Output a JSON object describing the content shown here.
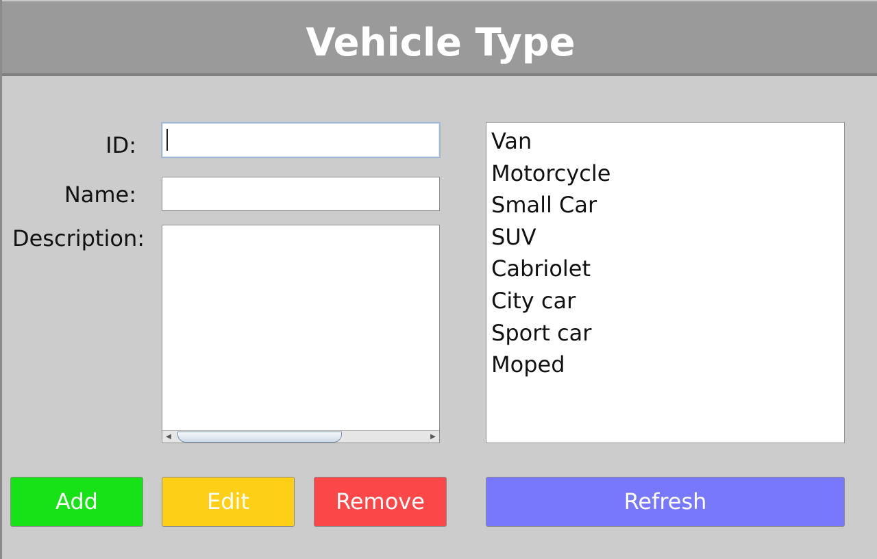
{
  "window": {
    "title": "Vehicle Type"
  },
  "form": {
    "id_label": "ID:",
    "id_value": "",
    "name_label": "Name:",
    "name_value": "",
    "description_label": "Description:",
    "description_value": ""
  },
  "vehicle_types": [
    "Van",
    "Motorcycle",
    "Small Car",
    "SUV",
    "Cabriolet",
    "City car",
    "Sport car",
    "Moped"
  ],
  "buttons": {
    "add": "Add",
    "edit": "Edit",
    "remove": "Remove",
    "refresh": "Refresh"
  },
  "colors": {
    "add": "#16e216",
    "edit": "#fdd017",
    "remove": "#fb4747",
    "refresh": "#7878fc",
    "header": "#9a9a9a",
    "background": "#cccccc"
  }
}
